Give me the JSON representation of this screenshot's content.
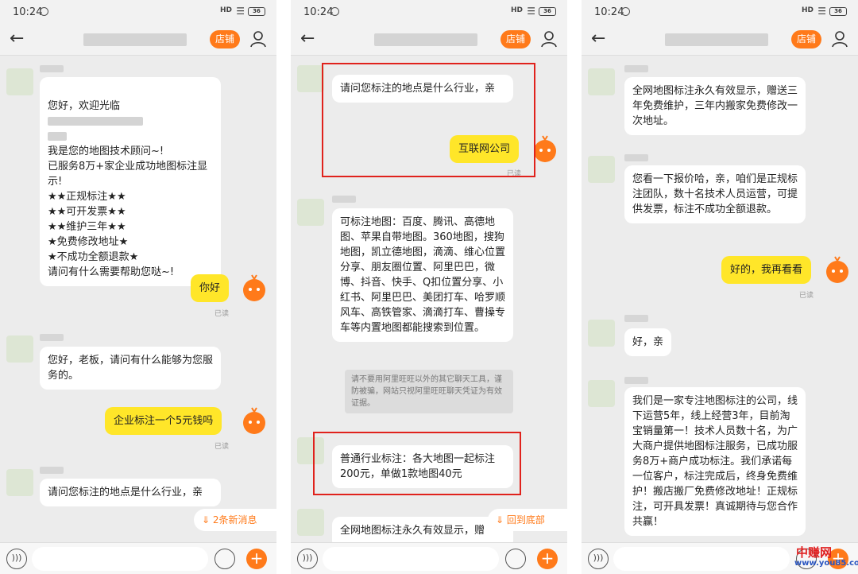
{
  "status": {
    "time": "10:24",
    "signal": "HD",
    "battery": "36"
  },
  "header": {
    "shop_label": "店铺"
  },
  "icons": {
    "back": "back-arrow-icon",
    "user": "user-icon",
    "voice": "voice-icon",
    "emoji": "emoji-icon",
    "plus": "plus-icon"
  },
  "colors": {
    "accent": "#ff7a1a",
    "user_bubble": "#ffe629",
    "highlight_box": "#e0221c"
  },
  "panel1": {
    "welcome_prefix": "您好，欢迎光临",
    "welcome_rest": "我是您的地图技术顾问~!\n已服务8万+家企业成功地图标注显示!\n★★正规标注★★\n★★可开发票★★\n★★维护三年★★\n★免费修改地址★\n★不成功全额退款★\n请问有什么需要帮助您哒~!",
    "reply_hello": "你好",
    "read1": "已读",
    "boss_msg": "您好，老板，请问有什么能够为您服务的。",
    "ask_price": "企业标注一个5元钱吗",
    "read2": "已读",
    "industry_q": "请问您标注的地点是什么行业，亲",
    "new_msgs": "2条新消息"
  },
  "panel2": {
    "industry_q": "请问您标注的地点是什么行业，亲",
    "answer": "互联网公司",
    "read": "已读",
    "maps_msg": "可标注地图：百度、腾讯、高德地图、苹果自带地图。360地图，搜狗地图，凯立德地图，滴滴、维心位置分享、朋友圈位置、阿里巴巴，微博、抖音、快手、Q扣位置分享、小红书、阿里巴巴、美团打车、哈罗顺风车、高铁管家、滴滴打车、曹操专车等内置地图都能搜索到位置。",
    "warning": "请不要用阿里旺旺以外的其它聊天工具，谨防被骗，网站只视阿里旺旺聊天凭证为有效证据。",
    "price_msg": "普通行业标注：各大地图一起标注200元，单做1款地图40元",
    "partial_msg": "全网地图标注永久有效显示，赠",
    "back_bottom": "回到底部"
  },
  "panel3": {
    "perm_msg": "全网地图标注永久有效显示，赠送三年免费维护，三年内搬家免费修改一次地址。",
    "quote_msg": "您看一下报价哈，亲，咱们是正规标注团队，数十名技术人员运营，可提供发票，标注不成功全额退款。",
    "reply": "好的，我再看看",
    "read": "已读",
    "ok_msg": "好，亲",
    "intro_msg": "我们是一家专注地图标注的公司，线下运营5年，线上经营3年，目前淘宝销量第一！技术人员数十名，为广大商户提供地图标注服务，已成功服务8万+商户成功标注。我们承诺每一位客户，标注完成后，终身免费维护！搬店搬厂免费修改地址！正规标注，可开具发票！真诚期待与您合作共赢！"
  },
  "watermark": {
    "cn": "中赚网",
    "url": "www.you85.com"
  }
}
